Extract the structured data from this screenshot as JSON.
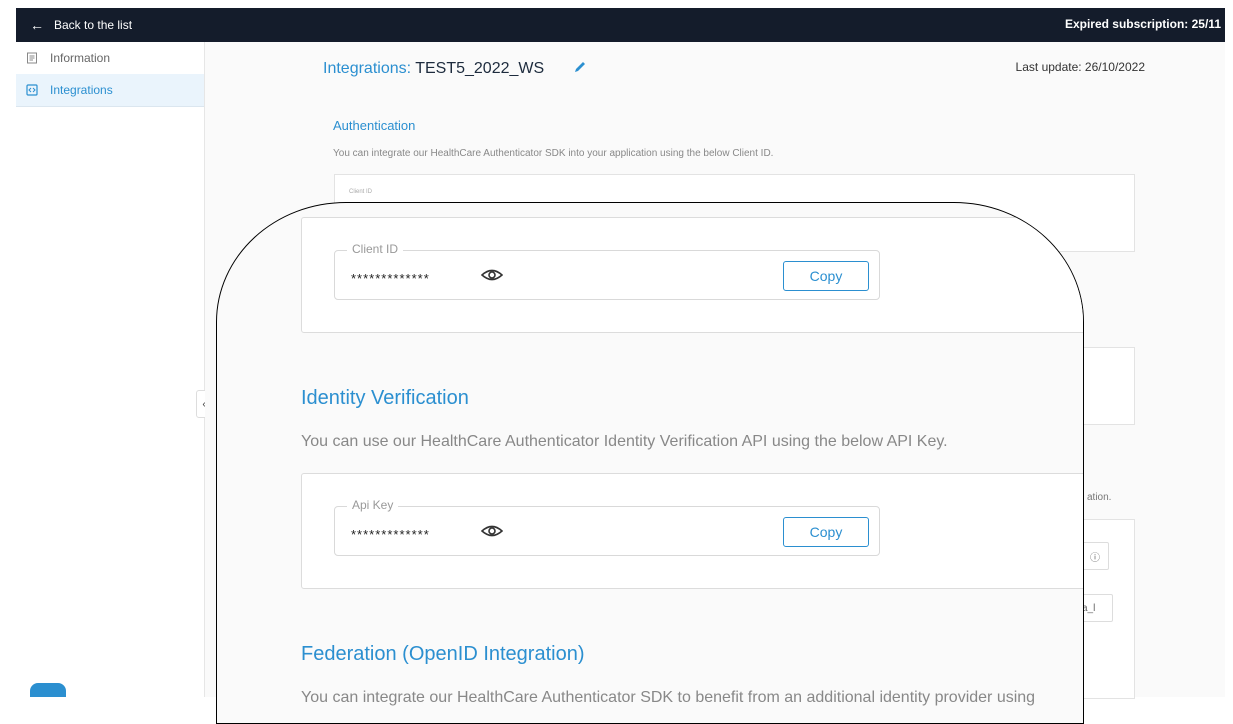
{
  "topbar": {
    "back_label": "Back to the list",
    "expired_label": "Expired subscription: 25/11"
  },
  "sidebar": {
    "items": [
      {
        "label": "Information",
        "icon": "document-icon"
      },
      {
        "label": "Integrations",
        "icon": "code-icon"
      }
    ]
  },
  "page": {
    "title_prefix": "Integrations:",
    "title_name": "TEST5_2022_WS",
    "last_update": "Last update: 26/10/2022"
  },
  "authentication": {
    "heading": "Authentication",
    "description": "You can integrate our HealthCare Authenticator SDK into your application using the below Client ID.",
    "field_label": "Client ID",
    "masked_value": "*************",
    "copy_label": "Copy"
  },
  "identity": {
    "heading": "Identity Verification",
    "description": "You can use our HealthCare Authenticator Identity Verification API using the below API Key.",
    "field_label": "Api Key",
    "masked_value": "*************",
    "copy_label": "Copy"
  },
  "federation": {
    "heading": "Federation (OpenID Integration)",
    "description": "You can integrate our HealthCare Authenticator SDK to benefit from an additional identity provider using"
  },
  "background_fragments": {
    "ation_text": "ation.",
    "info_icon_text": "ⓘ",
    "a_text": "a_l"
  },
  "colors": {
    "accent": "#2b8fd0",
    "topbar": "#141c2b"
  }
}
